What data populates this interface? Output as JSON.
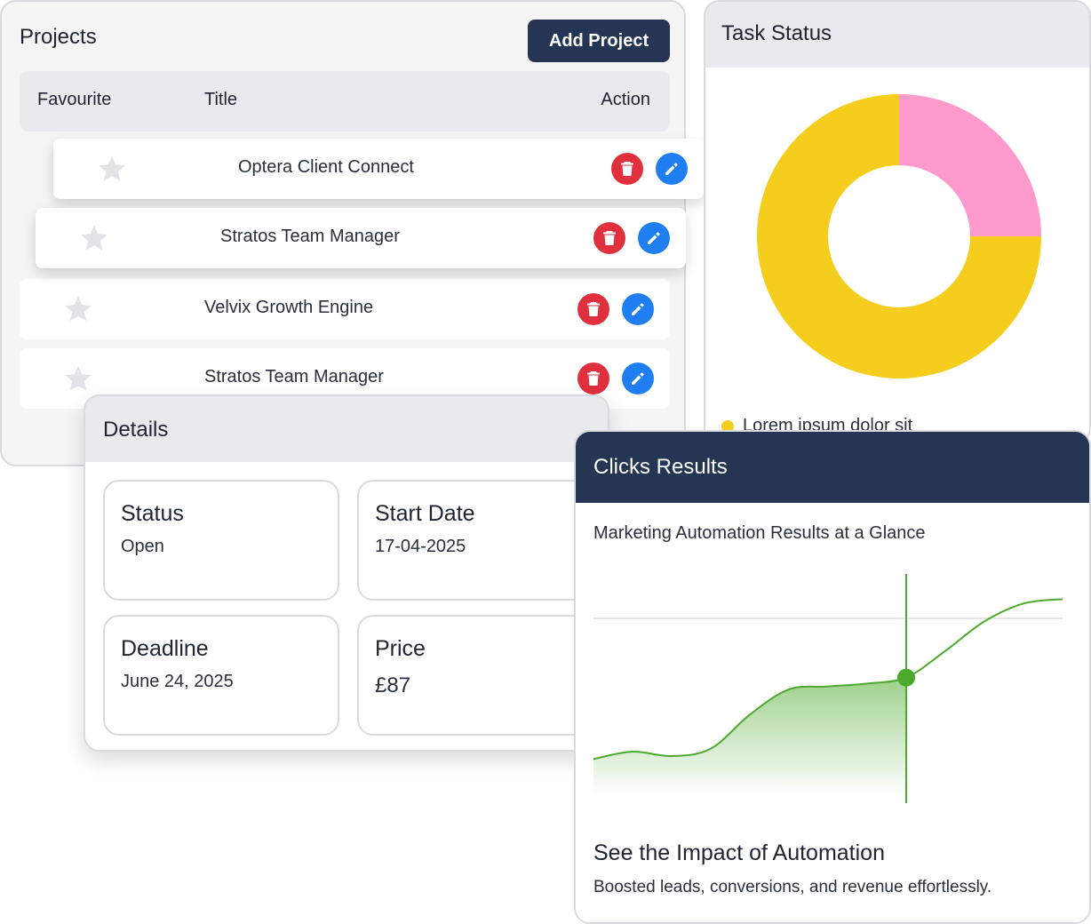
{
  "projects": {
    "title": "Projects",
    "add_button": "Add Project",
    "columns": {
      "favourite": "Favourite",
      "title": "Title",
      "action": "Action"
    },
    "rows": [
      {
        "title": "Optera Client Connect"
      },
      {
        "title": "Stratos Team Manager"
      },
      {
        "title": "Velvix Growth Engine"
      },
      {
        "title": "Stratos Team Manager"
      }
    ]
  },
  "task_status": {
    "title": "Task Status",
    "legend": [
      {
        "label": "Lorem ipsum dolor sit",
        "color": "#f5cd1d"
      }
    ]
  },
  "chart_data": [
    {
      "type": "pie",
      "title": "Task Status",
      "donut": true,
      "slices": [
        {
          "label": "Lorem ipsum dolor sit",
          "value": 75,
          "color": "#f5cd1d"
        },
        {
          "label": "",
          "value": 25,
          "color": "#ff9acd"
        }
      ]
    },
    {
      "type": "line",
      "title": "Clicks Results",
      "subtitle": "Marketing Automation Results at a Glance",
      "series": [
        {
          "values": [
            0.25,
            0.3,
            0.27,
            0.32,
            0.55,
            0.72,
            0.74,
            0.76,
            0.8,
            0.98,
            1.18,
            1.3,
            1.33
          ]
        }
      ],
      "highlight_index": 8,
      "color": "#4caa2c",
      "grid": "one horizontal reference line",
      "ylim": [
        0,
        1.5
      ]
    }
  ],
  "details": {
    "title": "Details",
    "status_label": "Status",
    "status_value": "Open",
    "start_label": "Start Date",
    "start_value": "17-04-2025",
    "deadline_label": "Deadline",
    "deadline_value": "June 24, 2025",
    "price_label": "Price",
    "price_value": "£87"
  },
  "clicks": {
    "title": "Clicks Results",
    "subtitle": "Marketing Automation Results at a Glance",
    "heading": "See the Impact of Automation",
    "text": "Boosted leads, conversions, and revenue effortlessly."
  },
  "colors": {
    "navy": "#243654",
    "delete": "#e0303d",
    "edit": "#1f7ef2",
    "yellow": "#f5cd1d",
    "pink": "#ff9acd",
    "green": "#4caa2c"
  },
  "icons": {
    "star": "star-icon",
    "delete": "trash-icon",
    "edit": "pencil-icon"
  }
}
